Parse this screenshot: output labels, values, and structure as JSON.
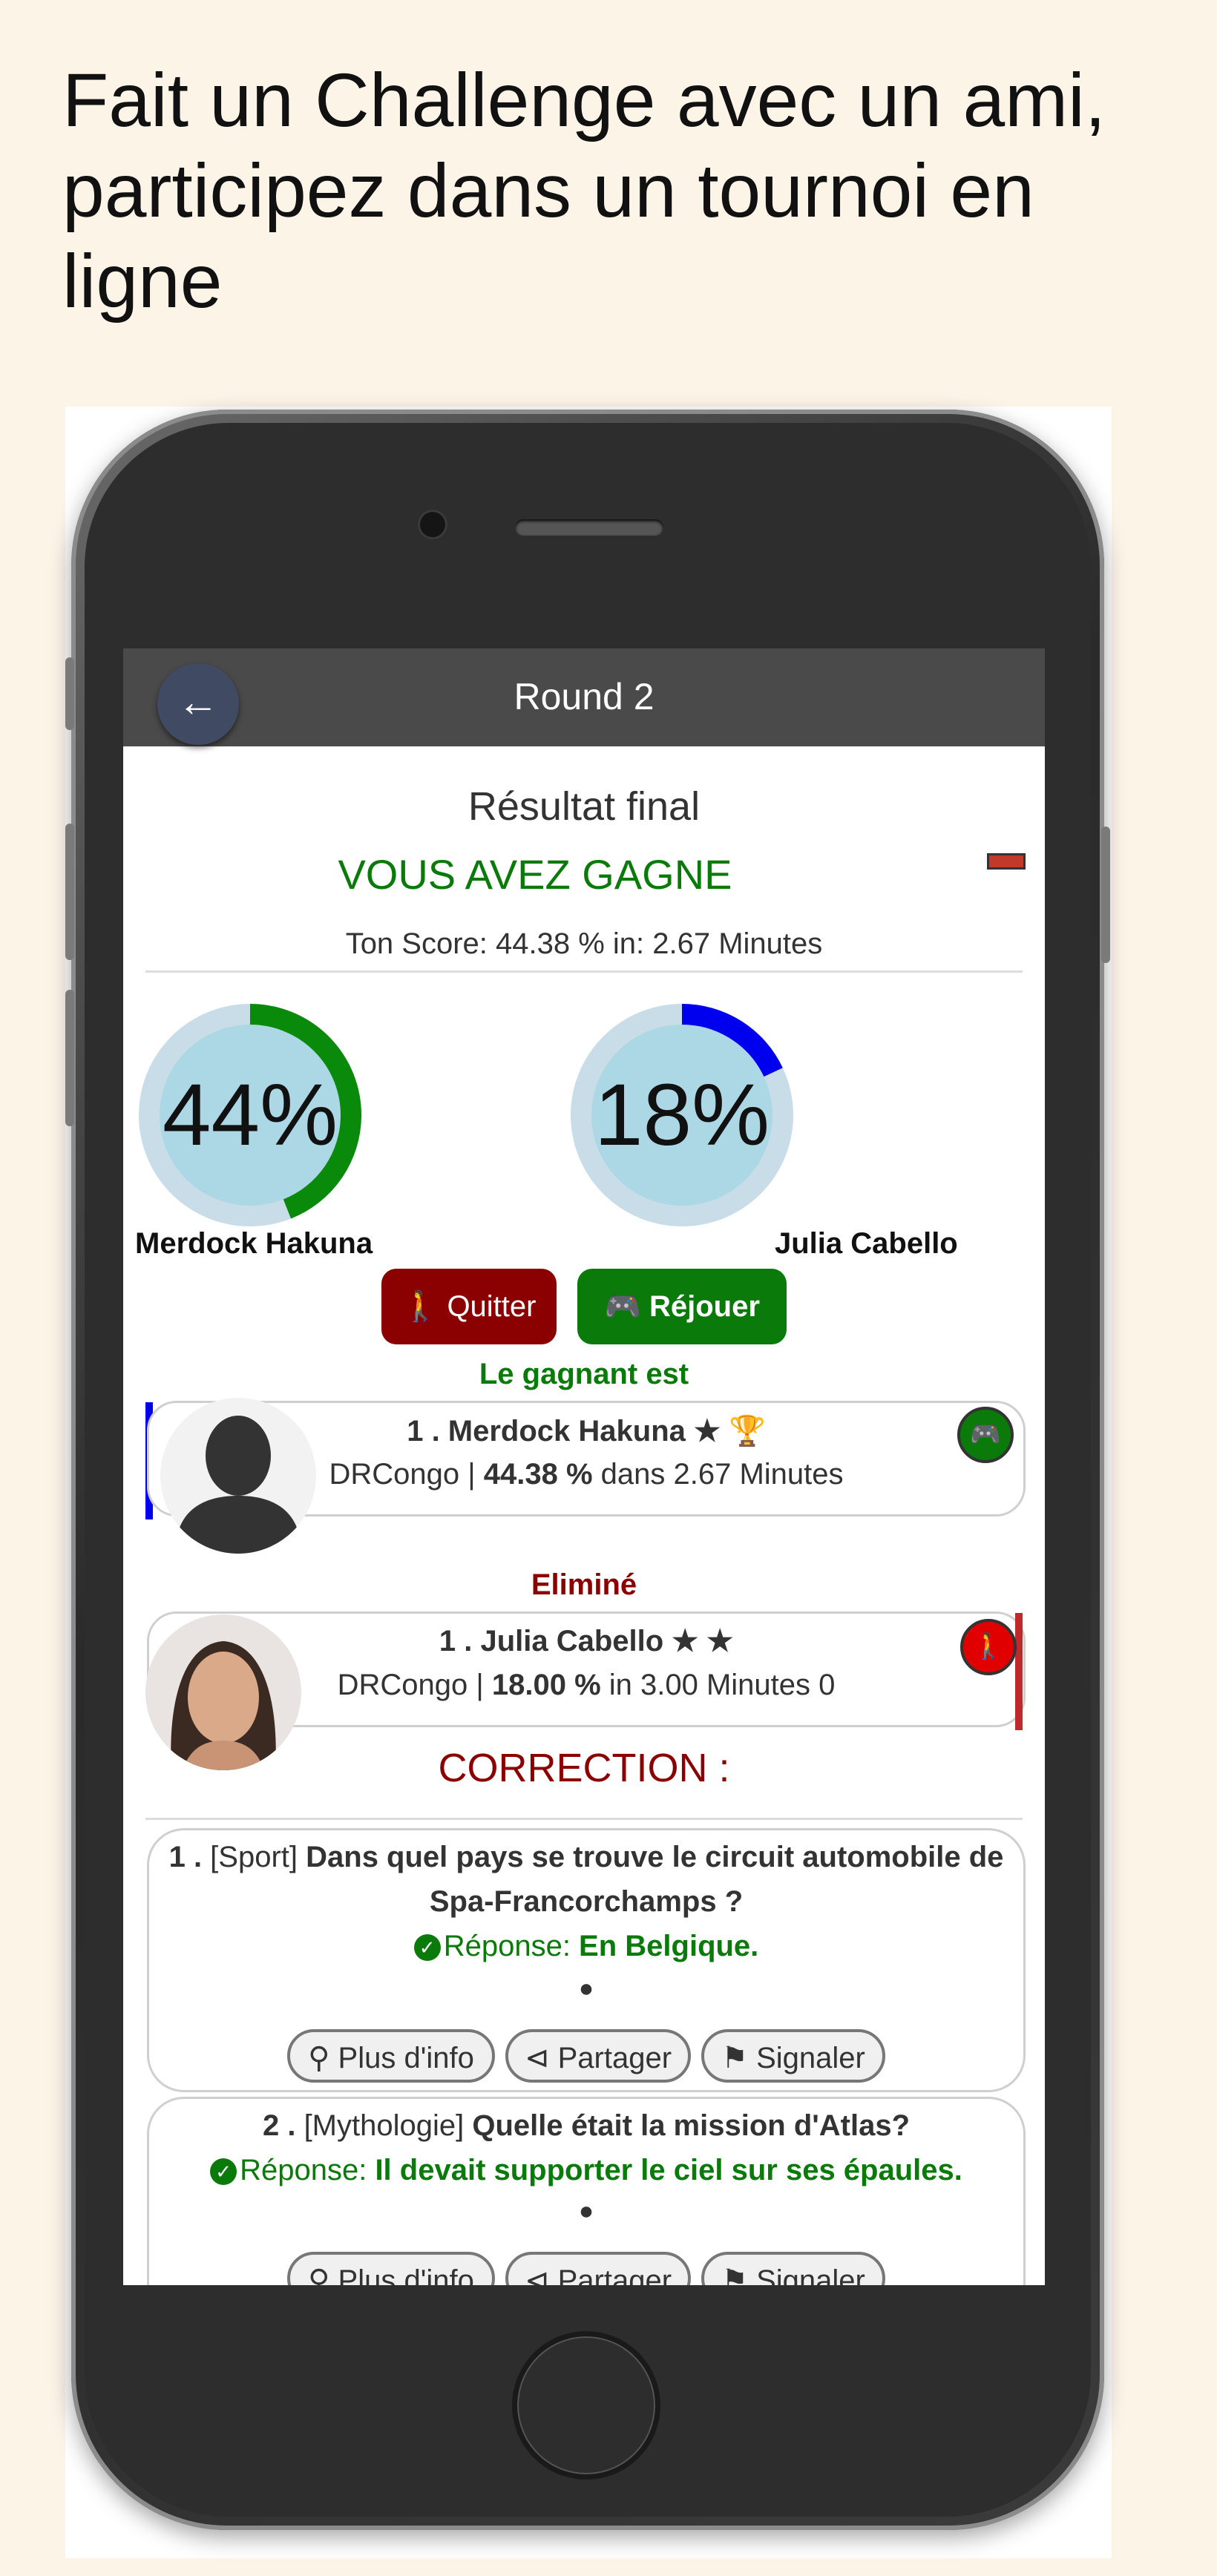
{
  "headline": "Fait un Challenge avec un ami, participez dans un tournoi en ligne",
  "topbar": {
    "title": "Round 2",
    "back_icon": "arrow-left-icon"
  },
  "result": {
    "title": "Résultat final",
    "status": "VOUS AVEZ GAGNE",
    "score_line": "Ton Score: 44.38 % in: 2.67 Minutes"
  },
  "players": [
    {
      "name": "Merdock Hakuna",
      "percent_label": "44%",
      "percent": 44,
      "color": "#0a8a0a"
    },
    {
      "name": "Julia Cabello",
      "percent_label": "18%",
      "percent": 18,
      "color": "#0000ee"
    }
  ],
  "buttons": {
    "quit": "Quitter",
    "replay": "Réjouer"
  },
  "winner": {
    "label": "Le gagnant est",
    "line1": "1 . Merdock Hakuna ★ 🏆",
    "country": "DRCongo | ",
    "score": "44.38 %",
    "rest": " dans 2.67 Minutes"
  },
  "eliminated": {
    "label": "Eliminé",
    "line1": "1 . Julia Cabello ★ ★",
    "country": "DRCongo | ",
    "score": "18.00 %",
    "rest": " in 3.00 Minutes 0"
  },
  "correction": {
    "title": "CORRECTION :",
    "questions": [
      {
        "num": "1 .",
        "category": " [Sport] ",
        "text": "Dans quel pays se trouve le circuit automobile de Spa-Francorchamps ?",
        "answer_label": "Réponse: ",
        "answer": "En Belgique."
      },
      {
        "num": "2 .",
        "category": " [Mythologie] ",
        "text": "Quelle était la mission d'Atlas?",
        "answer_label": "Réponse: ",
        "answer": "Il devait supporter le ciel sur ses épaules."
      }
    ],
    "actions": {
      "info": "Plus d'info",
      "share": "Partager",
      "report": "Signaler"
    }
  },
  "colors": {
    "win": "#0a7a0a",
    "quit": "#8b0000",
    "replay": "#0a7a0a",
    "topbar": "#4a4a4a"
  }
}
